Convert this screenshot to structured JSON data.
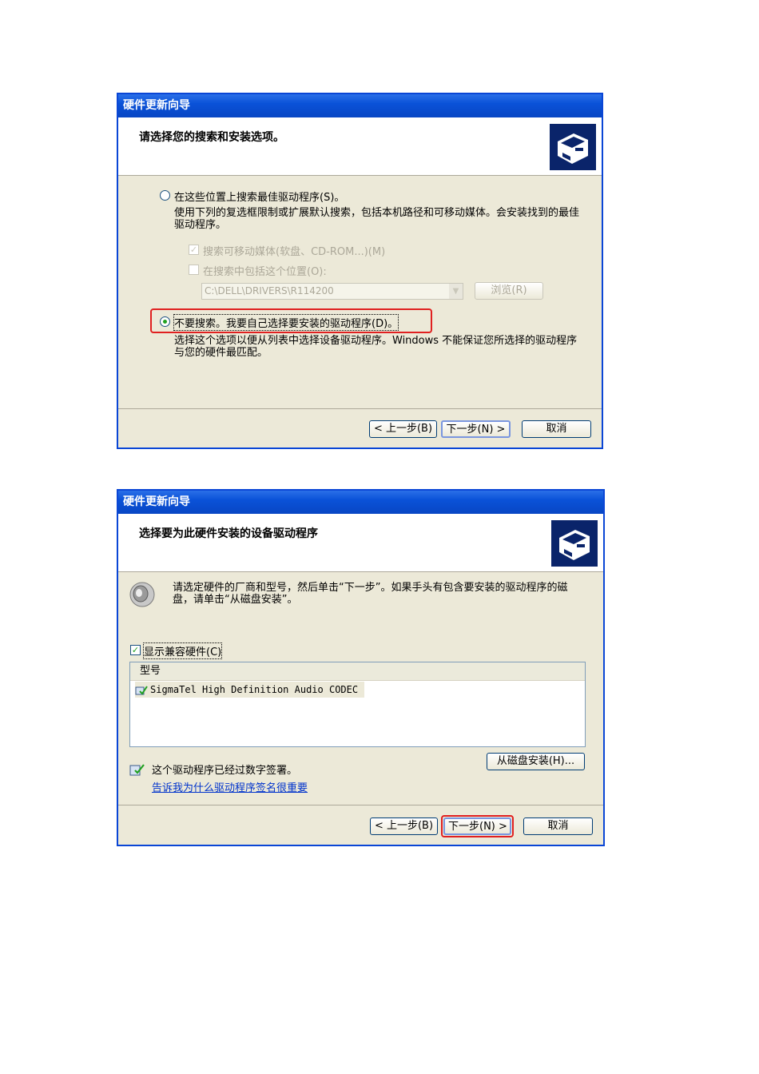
{
  "dialog1": {
    "title": "硬件更新向导",
    "header": "请选择您的搜索和安装选项。",
    "option_search": {
      "label": "在这些位置上搜索最佳驱动程序(S)。",
      "description": "使用下列的复选框限制或扩展默认搜索，包括本机路径和可移动媒体。会安装找到的最佳驱动程序。",
      "checked": false
    },
    "check_removable": {
      "label": "搜索可移动媒体(软盘、CD-ROM...)(M)",
      "checked": true,
      "enabled": false
    },
    "check_include_location": {
      "label": "在搜索中包括这个位置(O):",
      "checked": false,
      "enabled": false
    },
    "location_combo": {
      "value": "C:\\DELL\\DRIVERS\\R114200",
      "enabled": false
    },
    "browse_button": "浏览(R)",
    "option_manual": {
      "label": "不要搜索。我要自己选择要安装的驱动程序(D)。",
      "description": "选择这个选项以便从列表中选择设备驱动程序。Windows 不能保证您所选择的驱动程序与您的硬件最匹配。",
      "checked": true
    },
    "buttons": {
      "back": "< 上一步(B)",
      "next": "下一步(N) >",
      "cancel": "取消"
    }
  },
  "dialog2": {
    "title": "硬件更新向导",
    "header": "选择要为此硬件安装的设备驱动程序",
    "instruction": "请选定硬件的厂商和型号，然后单击“下一步”。如果手头有包含要安装的驱动程序的磁盘，请单击“从磁盘安装”。",
    "show_compatible": {
      "label": "显示兼容硬件(C)",
      "checked": true
    },
    "list": {
      "column_header": "型号",
      "items": [
        "SigmaTel High Definition Audio CODEC"
      ]
    },
    "signed_text": "这个驱动程序已经过数字签署。",
    "signed_link": "告诉我为什么驱动程序签名很重要",
    "have_disk_button": "从磁盘安装(H)...",
    "buttons": {
      "back": "< 上一步(B)",
      "next": "下一步(N) >",
      "cancel": "取消"
    }
  },
  "colors": {
    "titlebar": "#0a52d8",
    "highlight_box": "#e02020",
    "dialog_bg": "#ece9d8"
  }
}
